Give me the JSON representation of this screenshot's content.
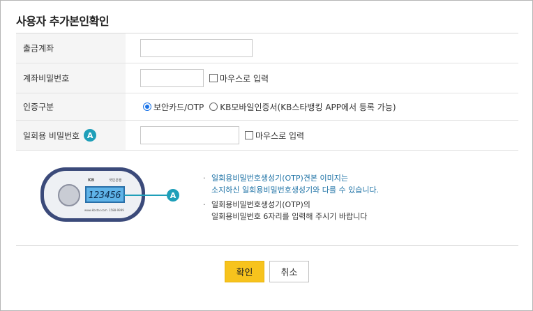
{
  "title": "사용자 추가본인확인",
  "form": {
    "account": {
      "label": "출금계좌",
      "value": ""
    },
    "password": {
      "label": "계좌비밀번호",
      "value": "",
      "mouse_label": "마우스로 입력"
    },
    "auth": {
      "label": "인증구분",
      "options": [
        {
          "label": "보안카드/OTP",
          "selected": true
        },
        {
          "label": "KB모바일인증서(KB스타뱅킹 APP에서 등록 가능)",
          "selected": false
        }
      ]
    },
    "otp": {
      "label": "일회용 비밀번호",
      "badge": "A",
      "value": "",
      "mouse_label": "마우스로 입력"
    }
  },
  "otp_device": {
    "brand": "KB",
    "bank": "국민은행",
    "display": "123456",
    "site": "www.kbstar.com",
    "phone": "1588-9999",
    "badge": "A"
  },
  "notes": [
    {
      "line1": "일회용비밀번호생성기(OTP)견본 이미지는",
      "line2": "소지하신 일회용비밀번호생성기와 다를 수 있습니다."
    },
    {
      "line1": "일회용비밀번호생성기(OTP)의",
      "line2": "일회용비밀번호 6자리를 입력해 주시기 바랍니다"
    }
  ],
  "buttons": {
    "ok": "확인",
    "cancel": "취소"
  },
  "colors": {
    "accent": "#f7c31d",
    "badge": "#1f9fb9",
    "note_blue": "#1f73a6"
  }
}
